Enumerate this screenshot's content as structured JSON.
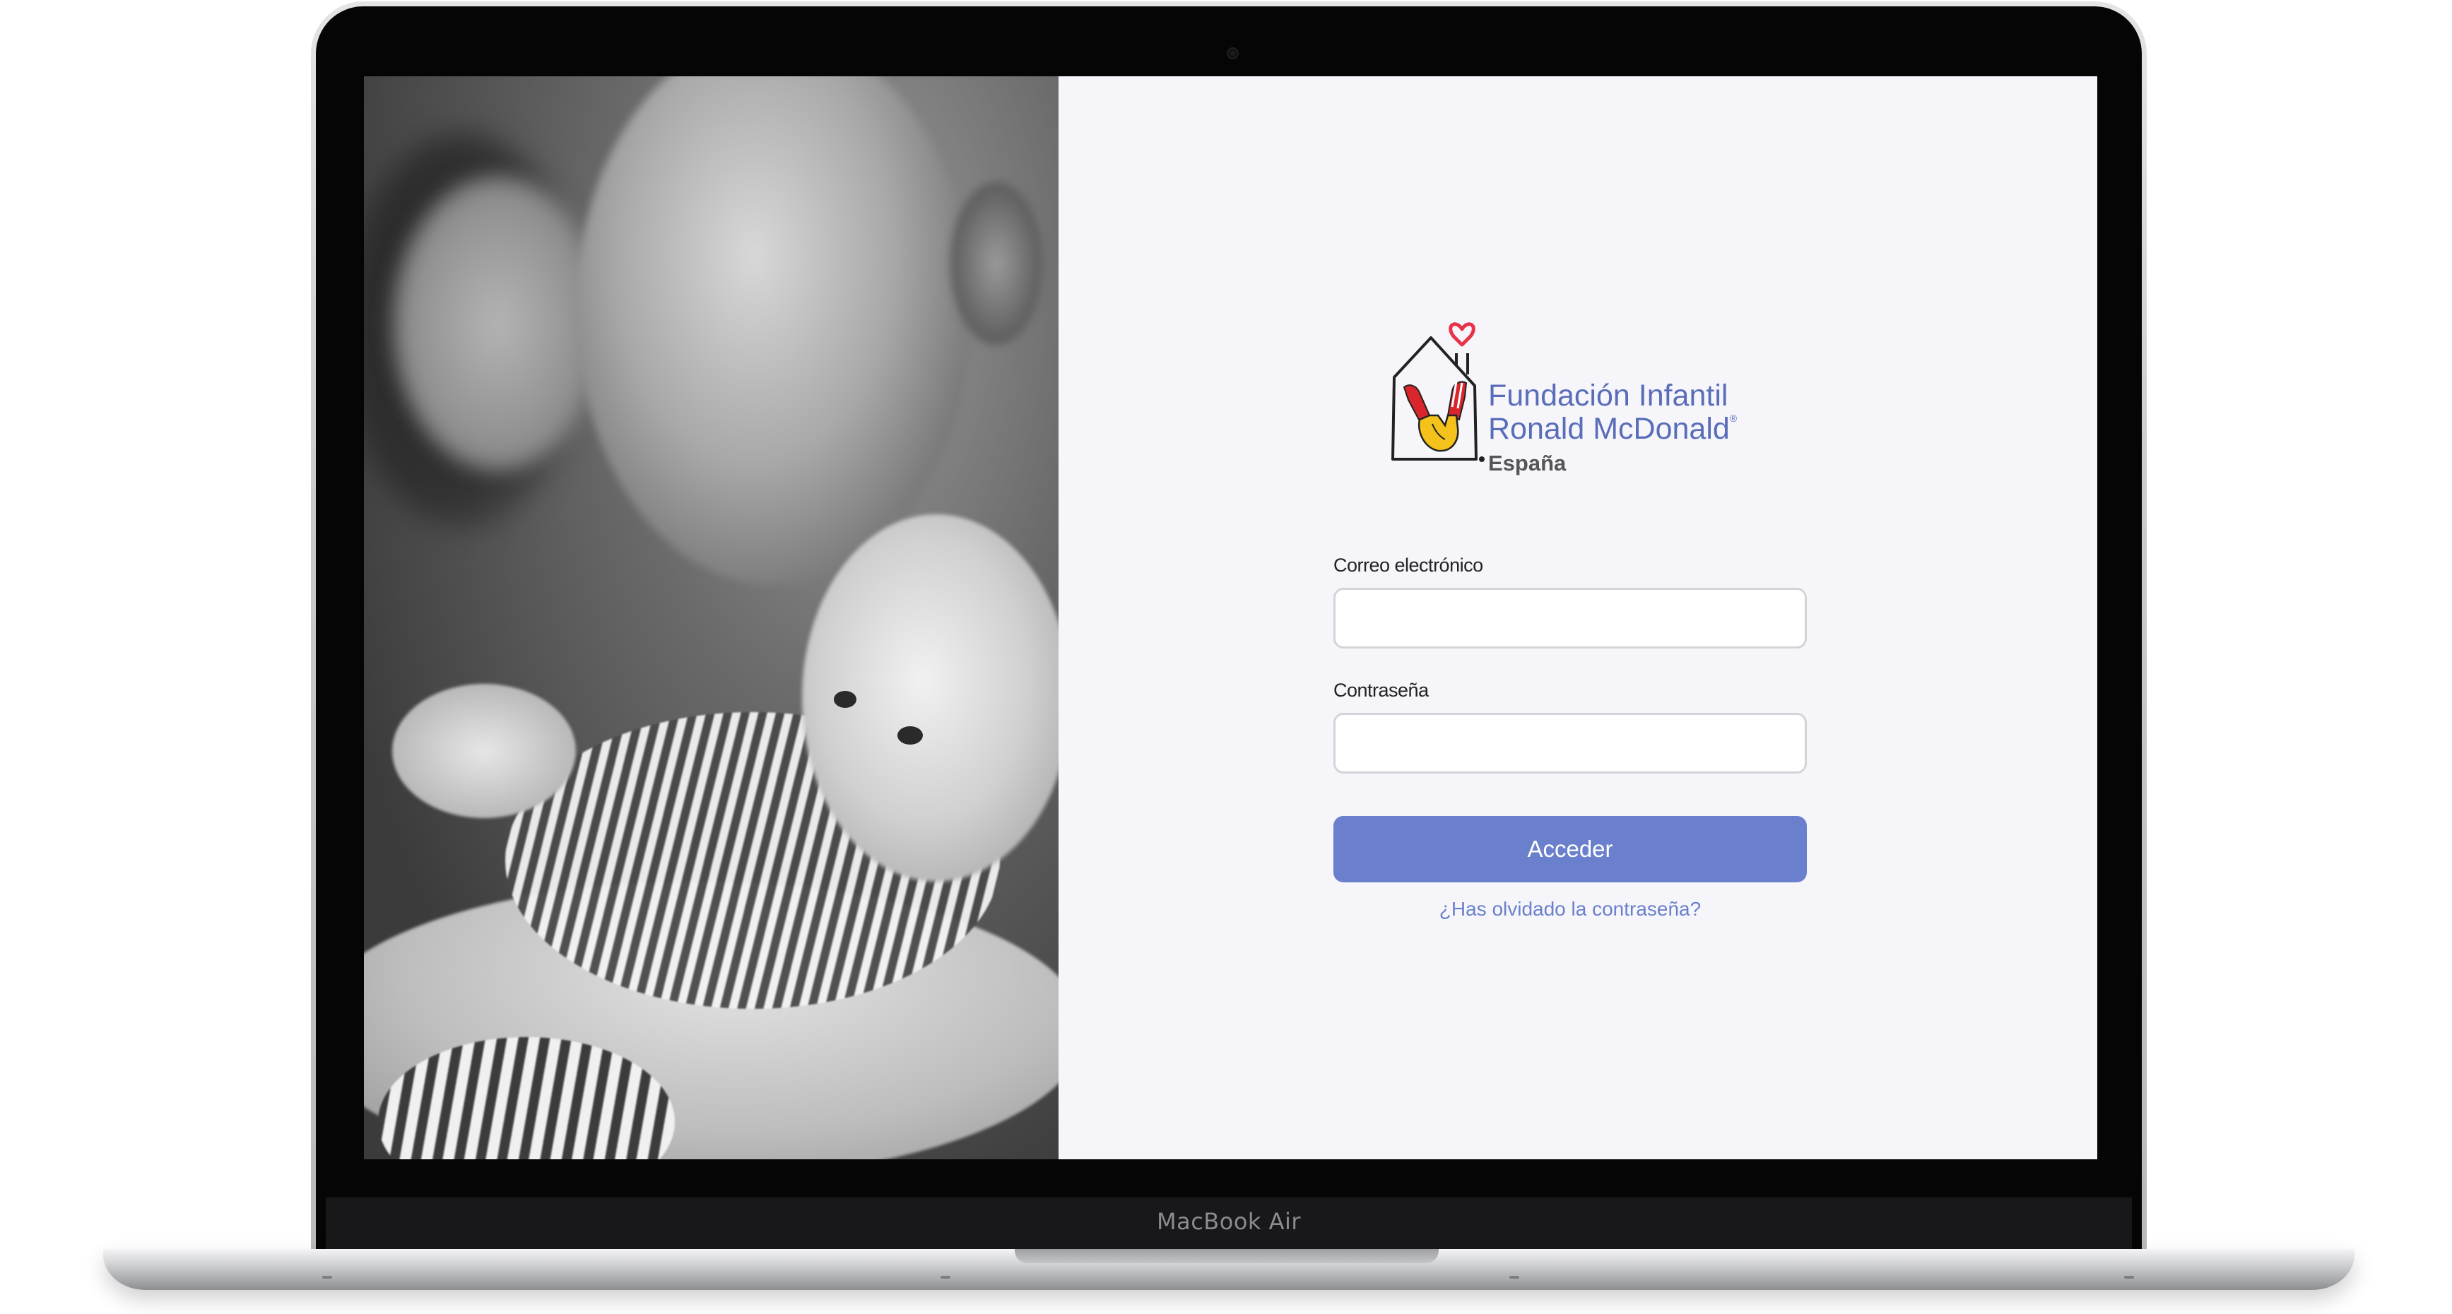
{
  "device": {
    "model_label": "MacBook Air"
  },
  "brand": {
    "name_line1": "Fundación Infantil",
    "name_line2": "Ronald McDonald",
    "registered_mark": "®",
    "country": "España",
    "logo_icon": "house-hands-heart-icon",
    "colors": {
      "text": "#5a6db8",
      "heart": "#e8324a",
      "red": "#d8262c",
      "yellow": "#f4c21a"
    }
  },
  "login": {
    "email_label": "Correo electrónico",
    "email_value": "",
    "password_label": "Contraseña",
    "password_value": "",
    "submit_label": "Acceder",
    "forgot_password_link": "¿Has olvidado la contraseña?"
  },
  "theme": {
    "accent": "#6b80cc",
    "panel_background": "#f6f6fa",
    "input_border": "#d4d4d8"
  }
}
